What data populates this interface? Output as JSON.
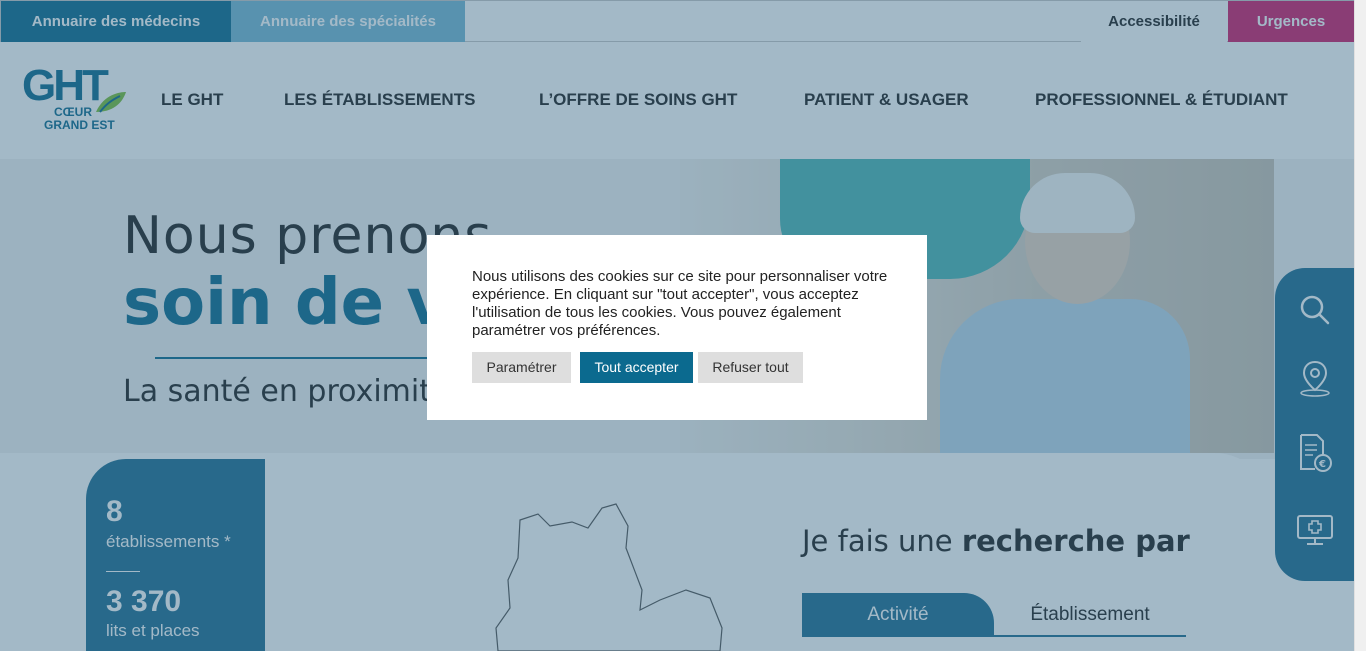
{
  "topbar": {
    "doctors_directory": "Annuaire des médecins",
    "specialties_directory": "Annuaire des spécialités",
    "accessibility": "Accessibilité",
    "emergencies": "Urgences"
  },
  "logo": {
    "main": "GHT",
    "line1": "CŒUR",
    "line2": "GRAND EST"
  },
  "nav": {
    "items": [
      {
        "label": "LE GHT"
      },
      {
        "label": "LES ÉTABLISSEMENTS"
      },
      {
        "label": "L’OFFRE DE SOINS GHT"
      },
      {
        "label": "PATIENT & USAGER"
      },
      {
        "label": "PROFESSIONNEL & ÉTUDIANT"
      }
    ]
  },
  "hero": {
    "line1": "Nous prenons",
    "line2": "soin de vous",
    "line3": "La santé en proximité"
  },
  "stats": [
    {
      "value": "8",
      "label": "établissements *"
    },
    {
      "value": "3 370",
      "label": "lits et places"
    }
  ],
  "search": {
    "title_prefix": "Je fais une ",
    "title_bold": "recherche par",
    "tabs": [
      {
        "label": "Activité"
      },
      {
        "label": "Établissement"
      }
    ]
  },
  "sidebar": {
    "icons": [
      "search-icon",
      "location-pin-icon",
      "invoice-euro-icon",
      "telemedicine-icon"
    ]
  },
  "cookie": {
    "text": "Nous utilisons des cookies sur ce site pour personnaliser votre expérience. En cliquant sur \"tout accepter\", vous acceptez l'utilisation de tous les cookies. Vous pouvez également paramétrer vos préférences.",
    "settings": "Paramétrer",
    "accept_all": "Tout accepter",
    "refuse_all": "Refuser tout"
  },
  "colors": {
    "brand_blue": "#0b6a8f",
    "light_blue": "#77b8d4",
    "emergency_pink": "#d11e6b"
  }
}
